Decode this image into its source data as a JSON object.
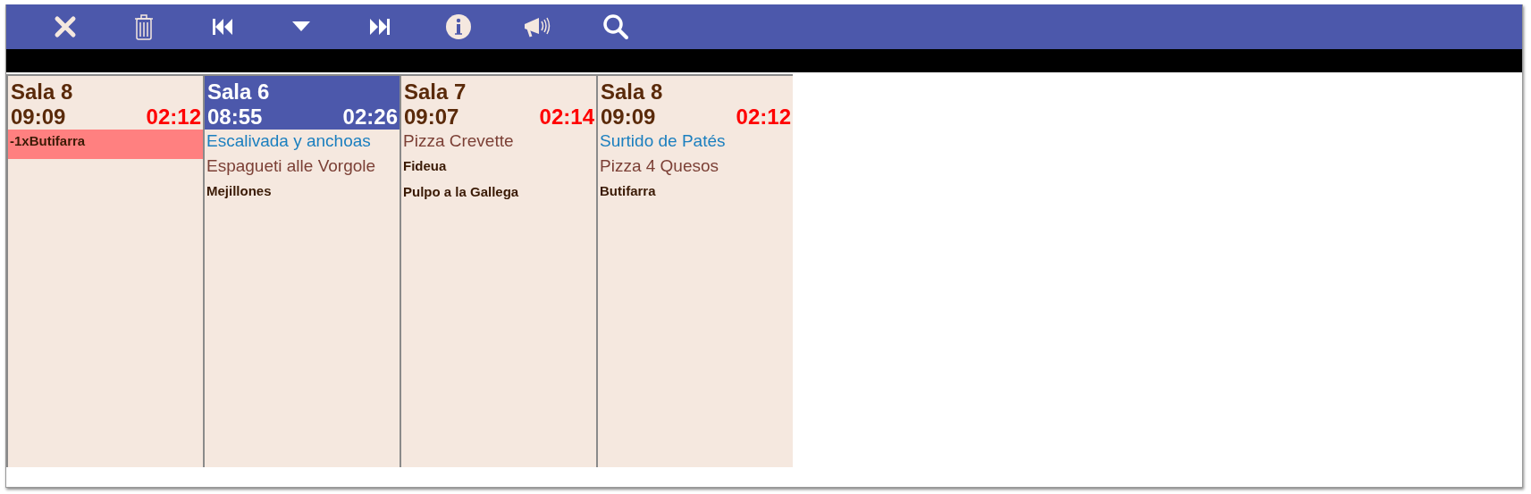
{
  "toolbar": {
    "buttons": [
      {
        "kind": "close"
      },
      {
        "kind": "trash"
      },
      {
        "kind": "first"
      },
      {
        "kind": "down"
      },
      {
        "kind": "last"
      },
      {
        "kind": "info"
      },
      {
        "kind": "announce"
      },
      {
        "kind": "search"
      }
    ]
  },
  "tickets": [
    {
      "room": "Sala 8",
      "time": "09:09",
      "elapsed": "02:12",
      "selected": false,
      "items": [
        {
          "text": "-1xButifarra",
          "kind": "alert"
        }
      ]
    },
    {
      "room": "Sala 6",
      "time": "08:55",
      "elapsed": "02:26",
      "selected": true,
      "items": [
        {
          "text": "Escalivada y anchoas",
          "kind": "starter"
        },
        {
          "text": "Espagueti alle Vorgole",
          "kind": "main"
        },
        {
          "text": "Mejillones",
          "kind": "plain"
        }
      ]
    },
    {
      "room": "Sala 7",
      "time": "09:07",
      "elapsed": "02:14",
      "selected": false,
      "items": [
        {
          "text": "Pizza Crevette",
          "kind": "main"
        },
        {
          "text": "Fideua",
          "kind": "plain"
        },
        {
          "text": "Pulpo a la Gallega",
          "kind": "plain"
        }
      ]
    },
    {
      "room": "Sala 8",
      "time": "09:09",
      "elapsed": "02:12",
      "selected": false,
      "items": [
        {
          "text": "Surtido de Patés",
          "kind": "starter"
        },
        {
          "text": "Pizza 4 Quesos",
          "kind": "main"
        },
        {
          "text": "Butifarra",
          "kind": "plain"
        }
      ]
    }
  ]
}
